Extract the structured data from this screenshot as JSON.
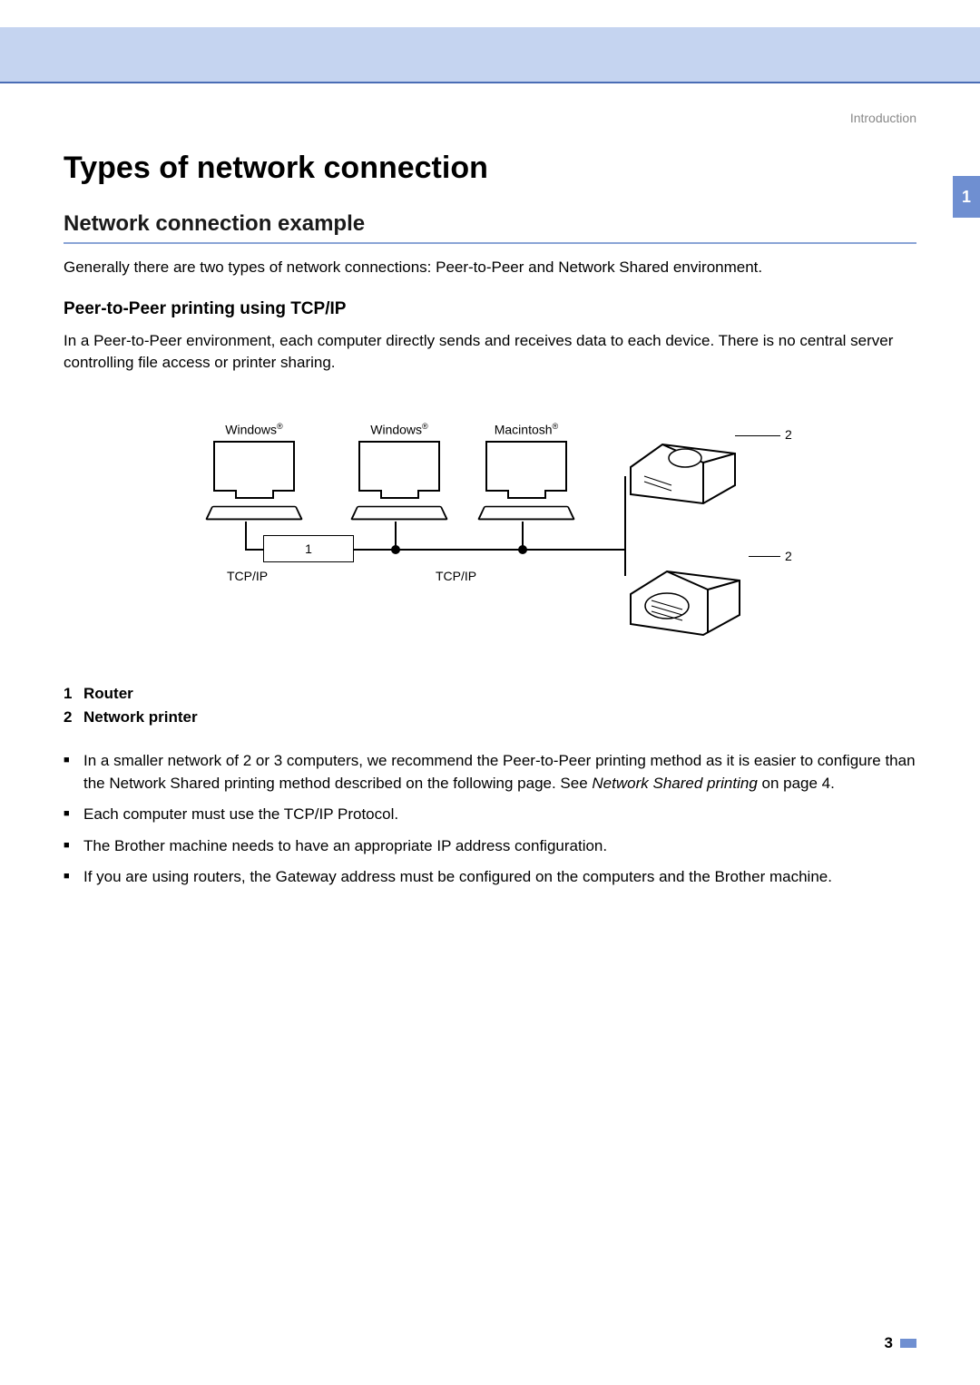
{
  "breadcrumb": "Introduction",
  "h1": "Types of network connection",
  "h2": "Network connection example",
  "intro": "Generally there are two types of network connections: Peer-to-Peer and Network Shared environment.",
  "h3_pre": "Peer",
  "h3_mid1": "-",
  "h3_to": "to",
  "h3_mid2": "-",
  "h3_post": "Peer printing using TCP/IP",
  "p2": "In a Peer-to-Peer environment, each computer directly sends and receives data to each device. There is no central server controlling file access or printer sharing.",
  "diagram": {
    "comp1_label_base": "Windows",
    "comp2_label_base": "Windows",
    "comp3_label_base": "Macintosh",
    "reg": "®",
    "router_num": "1",
    "tcpip1": "TCP/IP",
    "tcpip2": "TCP/IP",
    "callout_a": "2",
    "callout_b": "2"
  },
  "legend": [
    {
      "num": "1",
      "label": "Router"
    },
    {
      "num": "2",
      "label": "Network printer"
    }
  ],
  "bullets": {
    "b1_a": "In a smaller network of 2 or 3 computers, we recommend the Peer-to-Peer printing method as it is easier to configure than the Network Shared printing method described on the following page. See ",
    "b1_i": "Network Shared printing",
    "b1_b": " on page 4.",
    "b2": "Each computer must use the TCP/IP Protocol.",
    "b3": "The Brother machine needs to have an appropriate IP address configuration.",
    "b4": "If you are using routers, the Gateway address must be configured on the computers and the Brother machine."
  },
  "side_tab": "1",
  "page_number": "3"
}
